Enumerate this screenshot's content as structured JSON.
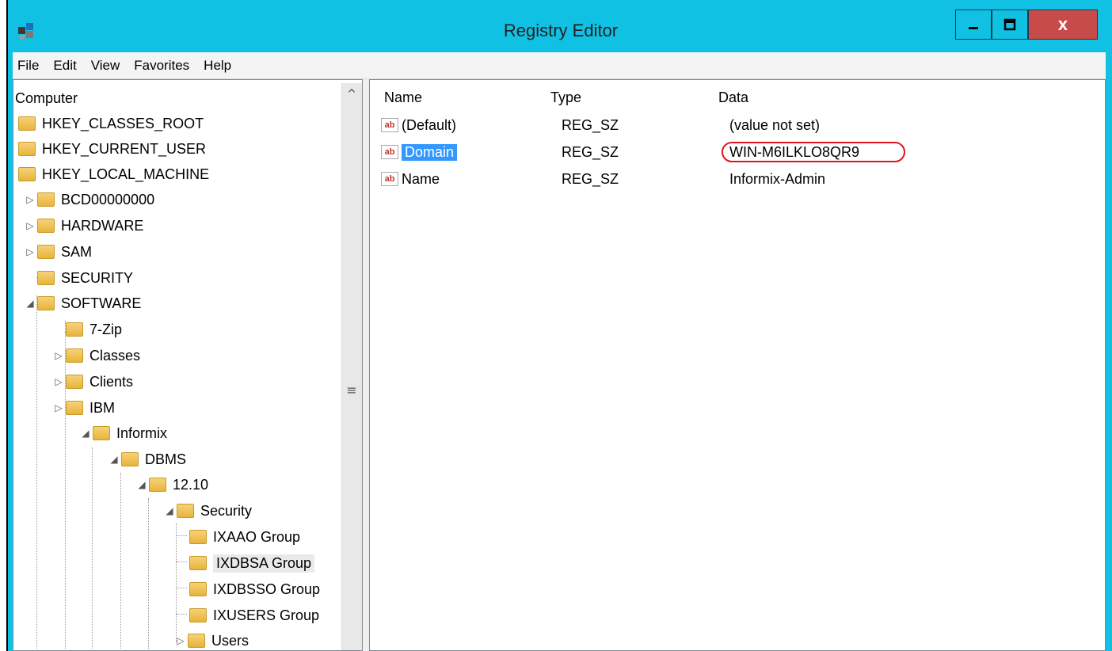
{
  "window": {
    "title": "Registry Editor",
    "close_label": "x",
    "accent_color": "#11c1e3"
  },
  "menu": [
    "File",
    "Edit",
    "View",
    "Favorites",
    "Help"
  ],
  "tree": {
    "root": "Computer",
    "items": [
      {
        "label": "HKEY_CLASSES_ROOT",
        "expander": ""
      },
      {
        "label": "HKEY_CURRENT_USER",
        "expander": ""
      },
      {
        "label": "HKEY_LOCAL_MACHINE",
        "expander": ""
      },
      {
        "label": "BCD00000000",
        "expander": "▷"
      },
      {
        "label": "HARDWARE",
        "expander": "▷"
      },
      {
        "label": "SAM",
        "expander": "▷"
      },
      {
        "label": "SECURITY",
        "expander": ""
      },
      {
        "label": "SOFTWARE",
        "expander": "◢"
      },
      {
        "label": "7-Zip",
        "expander": ""
      },
      {
        "label": "Classes",
        "expander": "▷"
      },
      {
        "label": "Clients",
        "expander": "▷"
      },
      {
        "label": "IBM",
        "expander": "▷"
      },
      {
        "label": "Informix",
        "expander": "◢"
      },
      {
        "label": "DBMS",
        "expander": "◢"
      },
      {
        "label": "12.10",
        "expander": "◢"
      },
      {
        "label": "Security",
        "expander": "◢"
      },
      {
        "label": "IXAAO Group",
        "expander": ""
      },
      {
        "label": "IXDBSA Group",
        "expander": ""
      },
      {
        "label": "IXDBSSO Group",
        "expander": ""
      },
      {
        "label": "IXUSERS Group",
        "expander": ""
      },
      {
        "label": "Users",
        "expander": "▷"
      }
    ],
    "scroll_up_glyph": "^",
    "scroll_grip_glyph": "≡"
  },
  "values": {
    "columns": [
      "Name",
      "Type",
      "Data"
    ],
    "rows": [
      {
        "name": "(Default)",
        "type": "REG_SZ",
        "data": "(value not set)"
      },
      {
        "name": "Domain",
        "type": "REG_SZ",
        "data": "WIN-M6ILKLO8QR9"
      },
      {
        "name": "Name",
        "type": "REG_SZ",
        "data": "Informix-Admin"
      }
    ],
    "icon_text": "ab",
    "selected_row": "Domain",
    "highlight_color": "#e0141b"
  }
}
